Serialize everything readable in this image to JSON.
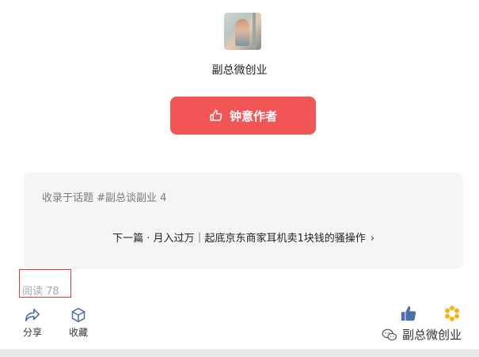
{
  "author": {
    "name": "副总微创业"
  },
  "like_button": {
    "label": "钟意作者"
  },
  "topic_card": {
    "topic_text": "收录于话题 #副总谈副业 4",
    "next_article": "下一篇 · 月入过万｜起底京东商家耳机卖1块钱的骚操作"
  },
  "stats": {
    "read_label": "阅读",
    "read_count": "78"
  },
  "actions": {
    "share_label": "分享",
    "favorite_label": "收藏"
  },
  "watermark": {
    "text": "副总微创业"
  },
  "colors": {
    "like_button": "#f25555",
    "card_bg": "#f5f5f5",
    "highlight_box": "#e03a3a",
    "thumb_blue": "#4d6fa8",
    "wow_yellow": "#f5b21a"
  }
}
